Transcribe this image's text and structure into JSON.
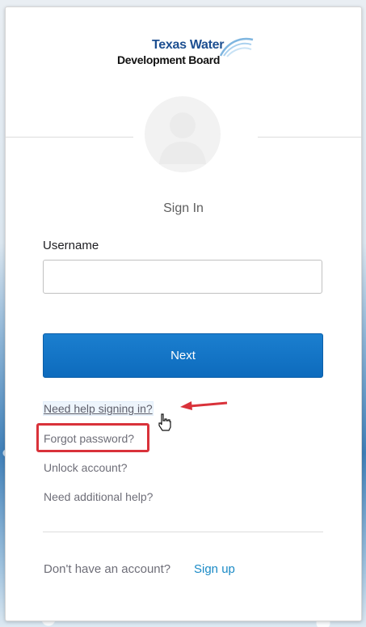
{
  "logo": {
    "line1": "Texas Water",
    "line2": "Development Board"
  },
  "title": "Sign In",
  "form": {
    "username_label": "Username",
    "username_value": "",
    "next_label": "Next"
  },
  "links": {
    "need_help": "Need help signing in?",
    "forgot_password": "Forgot password?",
    "unlock_account": "Unlock account?",
    "need_additional_help": "Need additional help?"
  },
  "footer": {
    "no_account_text": "Don't have an account?",
    "signup_label": "Sign up"
  },
  "colors": {
    "primary_button": "#0d6bbd",
    "signup_link": "#1a8ac6",
    "annotation_red": "#d9323a"
  },
  "icons": [
    "avatar-placeholder-icon",
    "water-splash-logo",
    "annotation-arrow-icon",
    "hand-cursor-icon"
  ]
}
